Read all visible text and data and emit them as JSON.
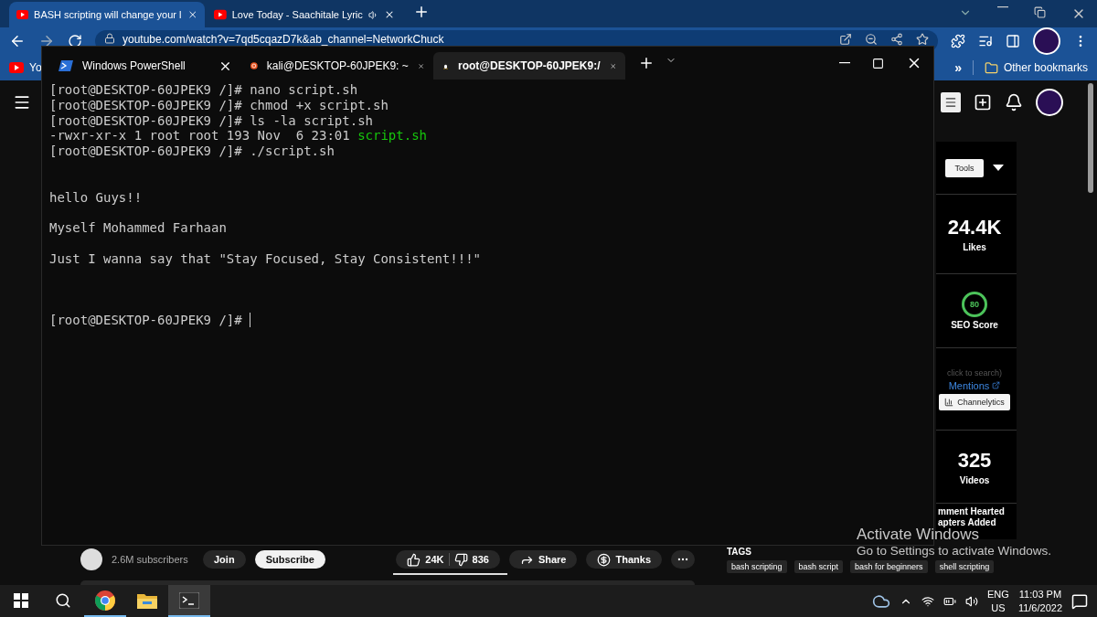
{
  "browser": {
    "tabs": [
      {
        "title": "BASH scripting will change your l",
        "selected": true,
        "audio": false
      },
      {
        "title": "Love Today - Saachitale Lyric",
        "selected": false,
        "audio": true
      }
    ],
    "address": "youtube.com/watch?v=7qd5cqazD7k&ab_channel=NetworkChuck",
    "bookmarks": {
      "left": "Yo",
      "overflow": "»",
      "folder": "Other bookmarks"
    }
  },
  "youtube": {
    "sidebar": {
      "tools_button": "Tools",
      "likes": {
        "value": "24.4K",
        "label": "Likes"
      },
      "seo": {
        "score": "80",
        "label": "SEO Score"
      },
      "search_hint": "click to search)",
      "mentions": "Mentions",
      "channelytics": "Channelytics",
      "videos": {
        "value": "325",
        "label": "Videos"
      },
      "features": [
        "mment Hearted",
        "apters Added"
      ]
    },
    "channel": {
      "subscribers": "2.6M subscribers",
      "join": "Join",
      "subscribe": "Subscribe"
    },
    "actions": {
      "likes": "24K",
      "dislikes": "836",
      "share": "Share",
      "thanks": "Thanks"
    },
    "tags_title": "TAGS",
    "tags": [
      "bash scripting",
      "bash script",
      "bash for beginners",
      "shell scripting"
    ]
  },
  "terminal": {
    "tabs": [
      {
        "title": "Windows PowerShell",
        "kind": "powershell",
        "selected": false
      },
      {
        "title": "kali@DESKTOP-60JPEK9: ~",
        "kind": "ubuntu",
        "selected": false
      },
      {
        "title": "root@DESKTOP-60JPEK9:/",
        "kind": "linux",
        "selected": true
      }
    ],
    "lines": [
      {
        "kind": "text",
        "segments": [
          {
            "text": "[root@DESKTOP-60JPEK9 /]# nano script.sh",
            "kind": "plain"
          }
        ]
      },
      {
        "kind": "text",
        "segments": [
          {
            "text": "[root@DESKTOP-60JPEK9 /]# chmod +x script.sh",
            "kind": "plain"
          }
        ]
      },
      {
        "kind": "text",
        "segments": [
          {
            "text": "[root@DESKTOP-60JPEK9 /]# ls -la script.sh",
            "kind": "plain"
          }
        ]
      },
      {
        "kind": "text",
        "segments": [
          {
            "text": "-rwxr-xr-x 1 root root 193 Nov  6 23:01 ",
            "kind": "plain"
          },
          {
            "text": "script.sh",
            "kind": "executable"
          }
        ]
      },
      {
        "kind": "text",
        "segments": [
          {
            "text": "[root@DESKTOP-60JPEK9 /]# ./script.sh",
            "kind": "plain"
          }
        ]
      },
      {
        "kind": "blank"
      },
      {
        "kind": "blank"
      },
      {
        "kind": "text",
        "segments": [
          {
            "text": "hello Guys!!",
            "kind": "plain"
          }
        ]
      },
      {
        "kind": "blank"
      },
      {
        "kind": "text",
        "segments": [
          {
            "text": "Myself Mohammed Farhaan",
            "kind": "plain"
          }
        ]
      },
      {
        "kind": "blank"
      },
      {
        "kind": "text",
        "segments": [
          {
            "text": "Just I wanna say that \"Stay Focused, Stay Consistent!!!\"",
            "kind": "plain"
          }
        ]
      },
      {
        "kind": "blank"
      },
      {
        "kind": "blank"
      },
      {
        "kind": "blank"
      },
      {
        "kind": "text",
        "segments": [
          {
            "text": "[root@DESKTOP-60JPEK9 /]# ",
            "kind": "plain"
          }
        ]
      }
    ],
    "cursor": true
  },
  "activation": {
    "title": "Activate Windows",
    "hint": "Go to Settings to activate Windows."
  },
  "taskbar": {
    "apps": [
      {
        "kind": "start",
        "running": false,
        "selected": false
      },
      {
        "kind": "search",
        "running": false,
        "selected": false
      },
      {
        "kind": "chrome",
        "running": true,
        "selected": false
      },
      {
        "kind": "files",
        "running": false,
        "selected": false
      },
      {
        "kind": "terminal",
        "running": true,
        "selected": true
      }
    ],
    "language": "ENG",
    "region": "US",
    "time": "11:03 PM",
    "date": "11/6/2022"
  }
}
